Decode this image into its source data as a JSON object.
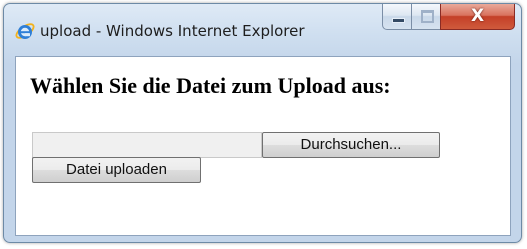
{
  "window": {
    "title": "upload - Windows Internet Explorer",
    "close_glyph": "X"
  },
  "icons": {
    "browser": "internet-explorer-icon",
    "minimize": "minimize-icon",
    "maximize": "maximize-icon",
    "close": "close-icon"
  },
  "page": {
    "heading": "Wählen Sie die Datei zum Upload aus:",
    "file_input": {
      "value": "",
      "browse_label": "Durchsuchen..."
    },
    "upload_label": "Datei uploaden"
  },
  "colors": {
    "close_button": "#c44028",
    "frame": "#c3d5ea"
  }
}
